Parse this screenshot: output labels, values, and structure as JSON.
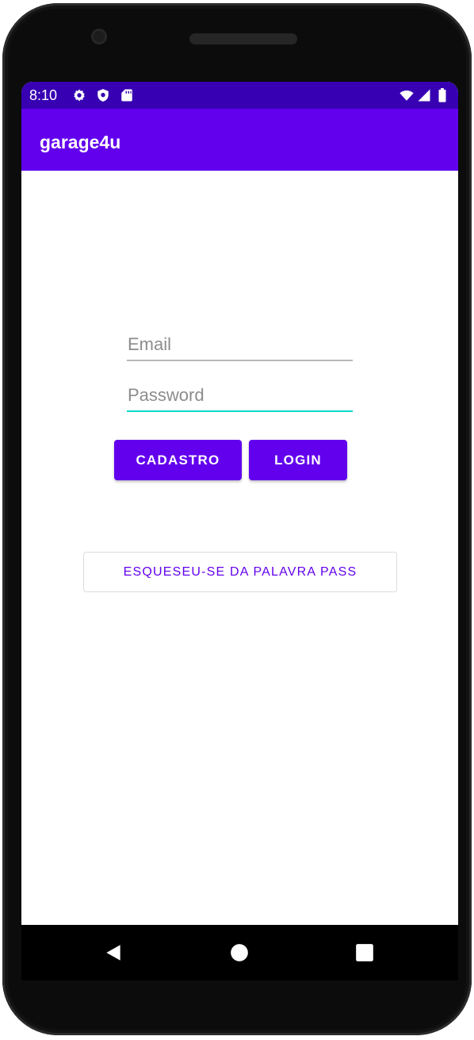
{
  "status_bar": {
    "time": "8:10",
    "icons": [
      "settings-icon",
      "shield-icon",
      "sd-card-icon",
      "wifi-icon",
      "cell-signal-icon",
      "battery-icon"
    ]
  },
  "app_bar": {
    "title": "garage4u",
    "color": "#6200ee",
    "status_color": "#3700b3"
  },
  "login_form": {
    "email_placeholder": "Email",
    "email_value": "",
    "password_placeholder": "Password",
    "password_value": "",
    "focus_color": "#03dac5"
  },
  "buttons": {
    "cadastro_label": "CADASTRO",
    "login_label": "LOGIN",
    "forgot_password_label": "ESQUESEU-SE DA PALAVRA PASS"
  },
  "nav_bar": {
    "icons": [
      "back-icon",
      "home-icon",
      "recents-icon"
    ]
  }
}
